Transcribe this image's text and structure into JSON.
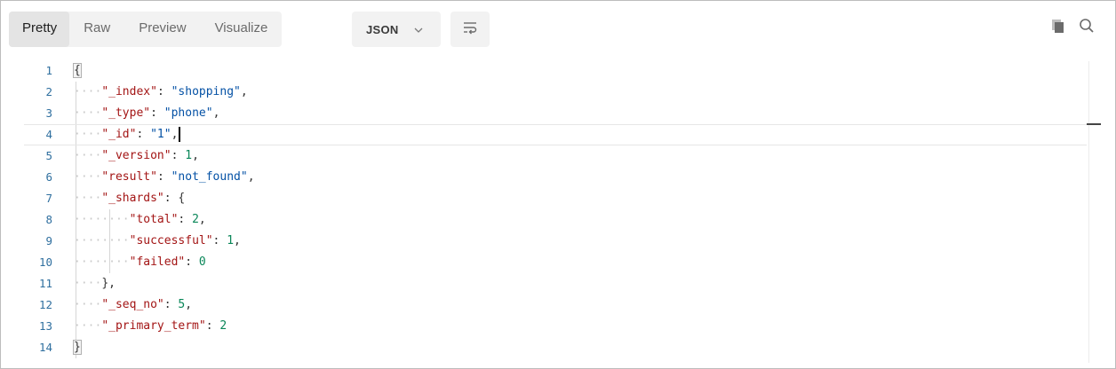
{
  "toolbar": {
    "tabs": [
      {
        "label": "Pretty"
      },
      {
        "label": "Raw"
      },
      {
        "label": "Preview"
      },
      {
        "label": "Visualize"
      }
    ],
    "active_tab": "Pretty",
    "format": "JSON",
    "icons": [
      "chevron-down-icon",
      "wrap-lines-icon",
      "copy-icon",
      "search-icon"
    ]
  },
  "editor": {
    "line_numbers": [
      "1",
      "2",
      "3",
      "4",
      "5",
      "6",
      "7",
      "8",
      "9",
      "10",
      "11",
      "12",
      "13",
      "14"
    ],
    "lines": [
      [
        {
          "t": "brace",
          "v": "{"
        }
      ],
      [
        {
          "t": "ws",
          "v": "····"
        },
        {
          "t": "key",
          "v": "\"_index\""
        },
        {
          "t": "punc",
          "v": ": "
        },
        {
          "t": "str",
          "v": "\"shopping\""
        },
        {
          "t": "punc",
          "v": ","
        }
      ],
      [
        {
          "t": "ws",
          "v": "····"
        },
        {
          "t": "key",
          "v": "\"_type\""
        },
        {
          "t": "punc",
          "v": ": "
        },
        {
          "t": "str",
          "v": "\"phone\""
        },
        {
          "t": "punc",
          "v": ","
        }
      ],
      [
        {
          "t": "ws",
          "v": "····"
        },
        {
          "t": "key",
          "v": "\"_id\""
        },
        {
          "t": "punc",
          "v": ": "
        },
        {
          "t": "str",
          "v": "\"1\""
        },
        {
          "t": "punc",
          "v": ","
        }
      ],
      [
        {
          "t": "ws",
          "v": "····"
        },
        {
          "t": "key",
          "v": "\"_version\""
        },
        {
          "t": "punc",
          "v": ": "
        },
        {
          "t": "num",
          "v": "1"
        },
        {
          "t": "punc",
          "v": ","
        }
      ],
      [
        {
          "t": "ws",
          "v": "····"
        },
        {
          "t": "key",
          "v": "\"result\""
        },
        {
          "t": "punc",
          "v": ": "
        },
        {
          "t": "str",
          "v": "\"not_found\""
        },
        {
          "t": "punc",
          "v": ","
        }
      ],
      [
        {
          "t": "ws",
          "v": "····"
        },
        {
          "t": "key",
          "v": "\"_shards\""
        },
        {
          "t": "punc",
          "v": ": "
        },
        {
          "t": "brace",
          "v": "{"
        }
      ],
      [
        {
          "t": "ws",
          "v": "········"
        },
        {
          "t": "key",
          "v": "\"total\""
        },
        {
          "t": "punc",
          "v": ": "
        },
        {
          "t": "num",
          "v": "2"
        },
        {
          "t": "punc",
          "v": ","
        }
      ],
      [
        {
          "t": "ws",
          "v": "········"
        },
        {
          "t": "key",
          "v": "\"successful\""
        },
        {
          "t": "punc",
          "v": ": "
        },
        {
          "t": "num",
          "v": "1"
        },
        {
          "t": "punc",
          "v": ","
        }
      ],
      [
        {
          "t": "ws",
          "v": "········"
        },
        {
          "t": "key",
          "v": "\"failed\""
        },
        {
          "t": "punc",
          "v": ": "
        },
        {
          "t": "num",
          "v": "0"
        }
      ],
      [
        {
          "t": "ws",
          "v": "····"
        },
        {
          "t": "brace",
          "v": "}"
        },
        {
          "t": "punc",
          "v": ","
        }
      ],
      [
        {
          "t": "ws",
          "v": "····"
        },
        {
          "t": "key",
          "v": "\"_seq_no\""
        },
        {
          "t": "punc",
          "v": ": "
        },
        {
          "t": "num",
          "v": "5"
        },
        {
          "t": "punc",
          "v": ","
        }
      ],
      [
        {
          "t": "ws",
          "v": "····"
        },
        {
          "t": "key",
          "v": "\"_primary_term\""
        },
        {
          "t": "punc",
          "v": ": "
        },
        {
          "t": "num",
          "v": "2"
        }
      ],
      [
        {
          "t": "brace",
          "v": "}"
        }
      ]
    ],
    "current_line": 4,
    "matched_brace_lines": [
      1,
      14
    ]
  },
  "colors": {
    "key": "#a31515",
    "string": "#0451a5",
    "number": "#098658",
    "line_number": "#2f6f9f",
    "whitespace_dots": "#c8c8c8"
  }
}
